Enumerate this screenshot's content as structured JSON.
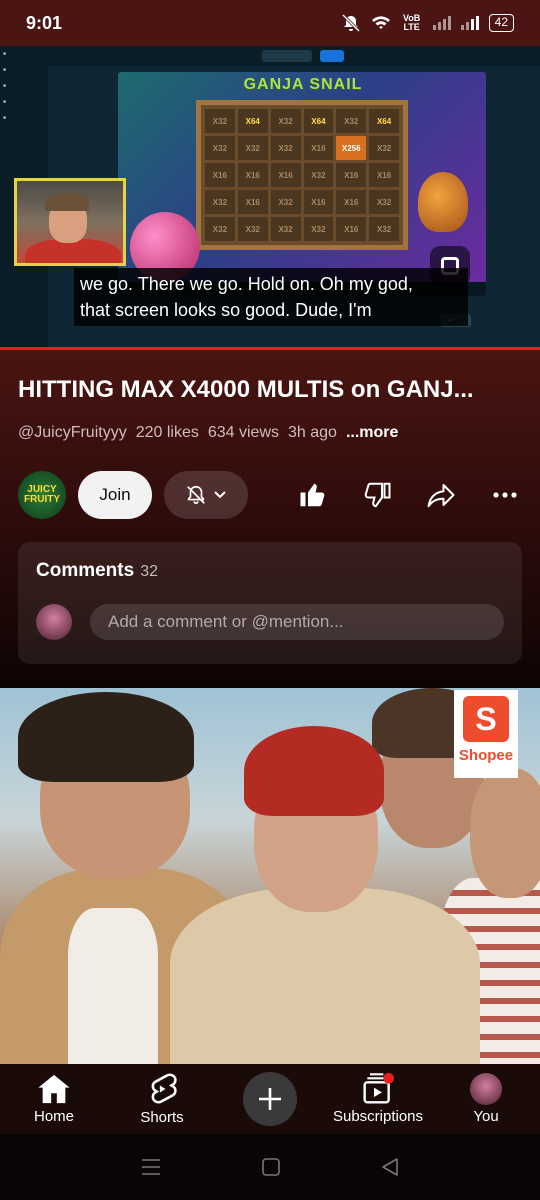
{
  "status_bar": {
    "time": "9:01",
    "volte": "VoB LTE",
    "battery": "42"
  },
  "video": {
    "caption_line1": "we go. There we go. Hold on. Oh my god,",
    "caption_line2": "that screen looks so good. Dude, I'm",
    "game_title": "GANJA SNAIL",
    "progress_fraction": 1.0,
    "grid": [
      [
        "X32",
        "X64",
        "X32",
        "X64",
        "X32",
        "X64"
      ],
      [
        "X32",
        "X32",
        "X32",
        "X16",
        "X256",
        "X32"
      ],
      [
        "X16",
        "X16",
        "X16",
        "X32",
        "X16",
        "X16"
      ],
      [
        "X32",
        "X16",
        "X32",
        "X16",
        "X16",
        "X32"
      ],
      [
        "X32",
        "X32",
        "X32",
        "X32",
        "X16",
        "X32"
      ]
    ]
  },
  "info": {
    "title": "HITTING MAX X4000 MULTIS on GANJ...",
    "channel": "@JuicyFruityyy",
    "likes": "220 likes",
    "views": "634 views",
    "age": "3h ago",
    "more": "...more",
    "channel_avatar_text": "JUICY FRUITY",
    "join": "Join"
  },
  "comments": {
    "label": "Comments",
    "count": "32",
    "placeholder": "Add a comment or @mention..."
  },
  "ad": {
    "brand": "Shopee",
    "brand_letter": "S"
  },
  "bottom_nav": {
    "home": "Home",
    "shorts": "Shorts",
    "subscriptions": "Subscriptions",
    "you": "You"
  },
  "colors": {
    "header_bg": "#4a1512",
    "shopee": "#ee4d2d",
    "progress": "#e62020"
  }
}
